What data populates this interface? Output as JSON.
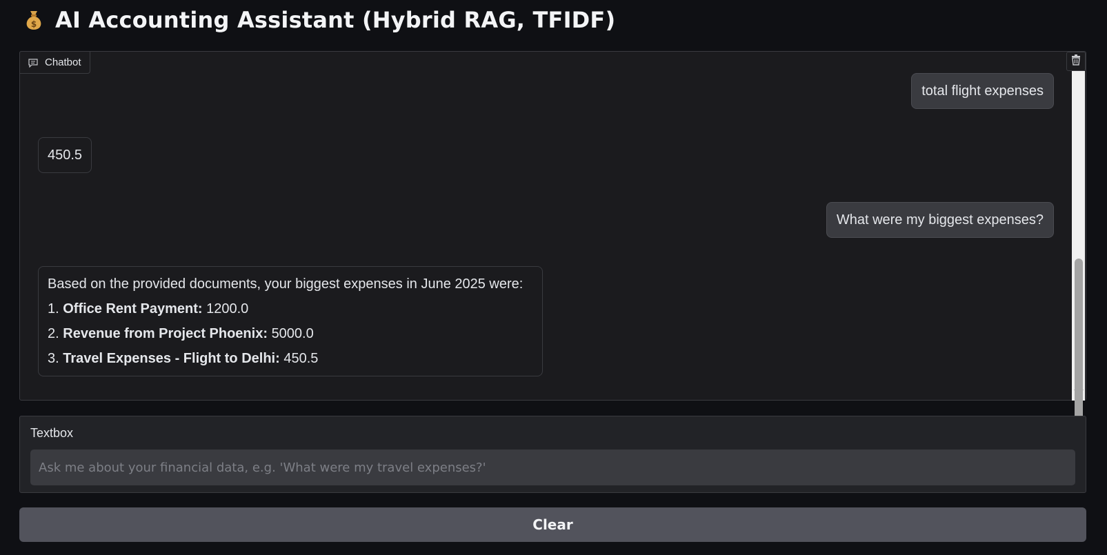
{
  "header": {
    "emoji": "money-bag-icon",
    "title": "AI Accounting Assistant (Hybrid RAG, TFIDF)"
  },
  "chatbot": {
    "label": "Chatbot",
    "messages": [
      {
        "role": "user",
        "text": "total flight expenses"
      },
      {
        "role": "bot",
        "text": "450.5"
      },
      {
        "role": "user",
        "text": "What were my biggest expenses?"
      },
      {
        "role": "bot",
        "intro": "Based on the provided documents, your biggest expenses in June 2025 were:",
        "items": [
          {
            "num": "1.",
            "label": "Office Rent Payment:",
            "value": "1200.0"
          },
          {
            "num": "2.",
            "label": "Revenue from Project Phoenix:",
            "value": "5000.0"
          },
          {
            "num": "3.",
            "label": "Travel Expenses - Flight to Delhi:",
            "value": "450.5"
          }
        ]
      }
    ]
  },
  "textbox": {
    "label": "Textbox",
    "placeholder": "Ask me about your financial data, e.g. 'What were my travel expenses?'",
    "value": ""
  },
  "clear_button": {
    "label": "Clear"
  },
  "colors": {
    "background": "#0f1014",
    "panel": "#1b1b1e",
    "user_bubble": "#3a3b40",
    "button": "#52535c"
  }
}
